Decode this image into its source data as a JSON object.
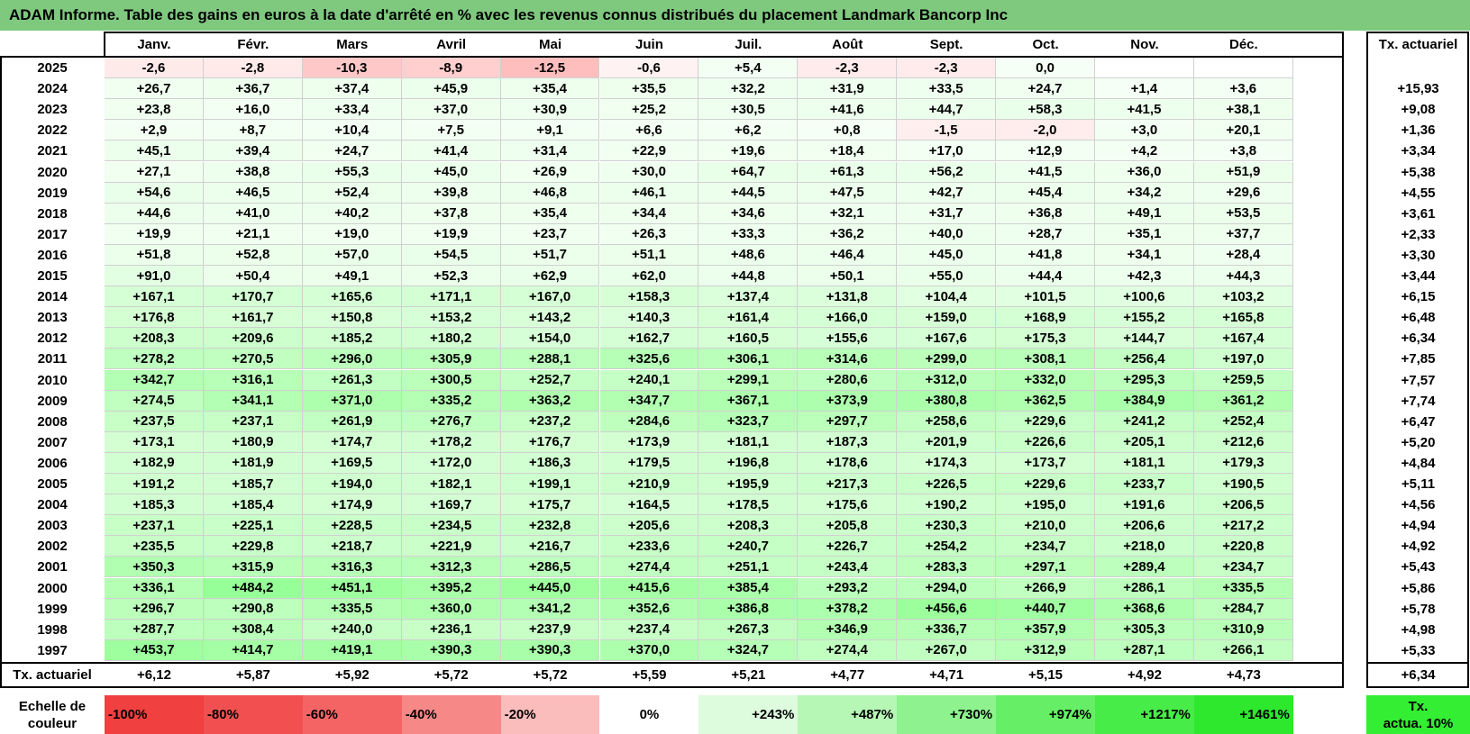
{
  "title": "ADAM Informe. Table des gains en euros à la date d'arrêté en % avec les revenus connus distribués du placement Landmark Bancorp Inc",
  "months": [
    "Janv.",
    "Févr.",
    "Mars",
    "Avril",
    "Mai",
    "Juin",
    "Juil.",
    "Août",
    "Sept.",
    "Oct.",
    "Nov.",
    "Déc."
  ],
  "annual_header": "Tx. actuariel",
  "rows": [
    {
      "year": "2025",
      "values": [
        "-2,6",
        "-2,8",
        "-10,3",
        "-8,9",
        "-12,5",
        "-0,6",
        "+5,4",
        "-2,3",
        "-2,3",
        "0,0",
        "",
        ""
      ],
      "annual": ""
    },
    {
      "year": "2024",
      "values": [
        "+26,7",
        "+36,7",
        "+37,4",
        "+45,9",
        "+35,4",
        "+35,5",
        "+32,2",
        "+31,9",
        "+33,5",
        "+24,7",
        "+1,4",
        "+3,6"
      ],
      "annual": "+15,93"
    },
    {
      "year": "2023",
      "values": [
        "+23,8",
        "+16,0",
        "+33,4",
        "+37,0",
        "+30,9",
        "+25,2",
        "+30,5",
        "+41,6",
        "+44,7",
        "+58,3",
        "+41,5",
        "+38,1"
      ],
      "annual": "+9,08"
    },
    {
      "year": "2022",
      "values": [
        "+2,9",
        "+8,7",
        "+10,4",
        "+7,5",
        "+9,1",
        "+6,6",
        "+6,2",
        "+0,8",
        "-1,5",
        "-2,0",
        "+3,0",
        "+20,1"
      ],
      "annual": "+1,36"
    },
    {
      "year": "2021",
      "values": [
        "+45,1",
        "+39,4",
        "+24,7",
        "+41,4",
        "+31,4",
        "+22,9",
        "+19,6",
        "+18,4",
        "+17,0",
        "+12,9",
        "+4,2",
        "+3,8"
      ],
      "annual": "+3,34"
    },
    {
      "year": "2020",
      "values": [
        "+27,1",
        "+38,8",
        "+55,3",
        "+45,0",
        "+26,9",
        "+30,0",
        "+64,7",
        "+61,3",
        "+56,2",
        "+41,5",
        "+36,0",
        "+51,9"
      ],
      "annual": "+5,38"
    },
    {
      "year": "2019",
      "values": [
        "+54,6",
        "+46,5",
        "+52,4",
        "+39,8",
        "+46,8",
        "+46,1",
        "+44,5",
        "+47,5",
        "+42,7",
        "+45,4",
        "+34,2",
        "+29,6"
      ],
      "annual": "+4,55"
    },
    {
      "year": "2018",
      "values": [
        "+44,6",
        "+41,0",
        "+40,2",
        "+37,8",
        "+35,4",
        "+34,4",
        "+34,6",
        "+32,1",
        "+31,7",
        "+36,8",
        "+49,1",
        "+53,5"
      ],
      "annual": "+3,61"
    },
    {
      "year": "2017",
      "values": [
        "+19,9",
        "+21,1",
        "+19,0",
        "+19,9",
        "+23,7",
        "+26,3",
        "+33,3",
        "+36,2",
        "+40,0",
        "+28,7",
        "+35,1",
        "+37,7"
      ],
      "annual": "+2,33"
    },
    {
      "year": "2016",
      "values": [
        "+51,8",
        "+52,8",
        "+57,0",
        "+54,5",
        "+51,7",
        "+51,1",
        "+48,6",
        "+46,4",
        "+45,0",
        "+41,8",
        "+34,1",
        "+28,4"
      ],
      "annual": "+3,30"
    },
    {
      "year": "2015",
      "values": [
        "+91,0",
        "+50,4",
        "+49,1",
        "+52,3",
        "+62,9",
        "+62,0",
        "+44,8",
        "+50,1",
        "+55,0",
        "+44,4",
        "+42,3",
        "+44,3"
      ],
      "annual": "+3,44"
    },
    {
      "year": "2014",
      "values": [
        "+167,1",
        "+170,7",
        "+165,6",
        "+171,1",
        "+167,0",
        "+158,3",
        "+137,4",
        "+131,8",
        "+104,4",
        "+101,5",
        "+100,6",
        "+103,2"
      ],
      "annual": "+6,15"
    },
    {
      "year": "2013",
      "values": [
        "+176,8",
        "+161,7",
        "+150,8",
        "+153,2",
        "+143,2",
        "+140,3",
        "+161,4",
        "+166,0",
        "+159,0",
        "+168,9",
        "+155,2",
        "+165,8"
      ],
      "annual": "+6,48"
    },
    {
      "year": "2012",
      "values": [
        "+208,3",
        "+209,6",
        "+185,2",
        "+180,2",
        "+154,0",
        "+162,7",
        "+160,5",
        "+155,6",
        "+167,6",
        "+175,3",
        "+144,7",
        "+167,4"
      ],
      "annual": "+6,34"
    },
    {
      "year": "2011",
      "values": [
        "+278,2",
        "+270,5",
        "+296,0",
        "+305,9",
        "+288,1",
        "+325,6",
        "+306,1",
        "+314,6",
        "+299,0",
        "+308,1",
        "+256,4",
        "+197,0"
      ],
      "annual": "+7,85"
    },
    {
      "year": "2010",
      "values": [
        "+342,7",
        "+316,1",
        "+261,3",
        "+300,5",
        "+252,7",
        "+240,1",
        "+299,1",
        "+280,6",
        "+312,0",
        "+332,0",
        "+295,3",
        "+259,5"
      ],
      "annual": "+7,57"
    },
    {
      "year": "2009",
      "values": [
        "+274,5",
        "+341,1",
        "+371,0",
        "+335,2",
        "+363,2",
        "+347,7",
        "+367,1",
        "+373,9",
        "+380,8",
        "+362,5",
        "+384,9",
        "+361,2"
      ],
      "annual": "+7,74"
    },
    {
      "year": "2008",
      "values": [
        "+237,5",
        "+237,1",
        "+261,9",
        "+276,7",
        "+237,2",
        "+284,6",
        "+323,7",
        "+297,7",
        "+258,6",
        "+229,6",
        "+241,2",
        "+252,4"
      ],
      "annual": "+6,47"
    },
    {
      "year": "2007",
      "values": [
        "+173,1",
        "+180,9",
        "+174,7",
        "+178,2",
        "+176,7",
        "+173,9",
        "+181,1",
        "+187,3",
        "+201,9",
        "+226,6",
        "+205,1",
        "+212,6"
      ],
      "annual": "+5,20"
    },
    {
      "year": "2006",
      "values": [
        "+182,9",
        "+181,9",
        "+169,5",
        "+172,0",
        "+186,3",
        "+179,5",
        "+196,8",
        "+178,6",
        "+174,3",
        "+173,7",
        "+181,1",
        "+179,3"
      ],
      "annual": "+4,84"
    },
    {
      "year": "2005",
      "values": [
        "+191,2",
        "+185,7",
        "+194,0",
        "+182,1",
        "+199,1",
        "+210,9",
        "+195,9",
        "+217,3",
        "+226,5",
        "+229,6",
        "+233,7",
        "+190,5"
      ],
      "annual": "+5,11"
    },
    {
      "year": "2004",
      "values": [
        "+185,3",
        "+185,4",
        "+174,9",
        "+169,7",
        "+175,7",
        "+164,5",
        "+178,5",
        "+175,6",
        "+190,2",
        "+195,0",
        "+191,6",
        "+206,5"
      ],
      "annual": "+4,56"
    },
    {
      "year": "2003",
      "values": [
        "+237,1",
        "+225,1",
        "+228,5",
        "+234,5",
        "+232,8",
        "+205,6",
        "+208,3",
        "+205,8",
        "+230,3",
        "+210,0",
        "+206,6",
        "+217,2"
      ],
      "annual": "+4,94"
    },
    {
      "year": "2002",
      "values": [
        "+235,5",
        "+229,8",
        "+218,7",
        "+221,9",
        "+216,7",
        "+233,6",
        "+240,7",
        "+226,7",
        "+254,2",
        "+234,7",
        "+218,0",
        "+220,8"
      ],
      "annual": "+4,92"
    },
    {
      "year": "2001",
      "values": [
        "+350,3",
        "+315,9",
        "+316,3",
        "+312,3",
        "+286,5",
        "+274,4",
        "+251,1",
        "+243,4",
        "+283,3",
        "+297,1",
        "+289,4",
        "+234,7"
      ],
      "annual": "+5,43"
    },
    {
      "year": "2000",
      "values": [
        "+336,1",
        "+484,2",
        "+451,1",
        "+395,2",
        "+445,0",
        "+415,6",
        "+385,4",
        "+293,2",
        "+294,0",
        "+266,9",
        "+286,1",
        "+335,5"
      ],
      "annual": "+5,86"
    },
    {
      "year": "1999",
      "values": [
        "+296,7",
        "+290,8",
        "+335,5",
        "+360,0",
        "+341,2",
        "+352,6",
        "+386,8",
        "+378,2",
        "+456,6",
        "+440,7",
        "+368,6",
        "+284,7"
      ],
      "annual": "+5,78"
    },
    {
      "year": "1998",
      "values": [
        "+287,7",
        "+308,4",
        "+240,0",
        "+236,1",
        "+237,9",
        "+237,4",
        "+267,3",
        "+346,9",
        "+336,7",
        "+357,9",
        "+305,3",
        "+310,9"
      ],
      "annual": "+4,98"
    },
    {
      "year": "1997",
      "values": [
        "+453,7",
        "+414,7",
        "+419,1",
        "+390,3",
        "+390,3",
        "+370,0",
        "+324,7",
        "+274,4",
        "+267,0",
        "+312,9",
        "+287,1",
        "+266,1"
      ],
      "annual": "+5,33"
    }
  ],
  "footer": {
    "label": "Tx. actuariel",
    "values": [
      "+6,12",
      "+5,87",
      "+5,92",
      "+5,72",
      "+5,72",
      "+5,59",
      "+5,21",
      "+4,77",
      "+4,71",
      "+5,15",
      "+4,92",
      "+4,73"
    ],
    "annual": "+6,34"
  },
  "scale": {
    "label_line1": "Echelle de",
    "label_line2": "couleur",
    "items": [
      {
        "text": "-100%",
        "color": "#f04040",
        "align": "left"
      },
      {
        "text": "-80%",
        "color": "#f25050",
        "align": "left"
      },
      {
        "text": "-60%",
        "color": "#f46464",
        "align": "left"
      },
      {
        "text": "-40%",
        "color": "#f78888",
        "align": "left"
      },
      {
        "text": "-20%",
        "color": "#fbbcbc",
        "align": "left"
      },
      {
        "text": "0%",
        "color": "#ffffff",
        "align": "center"
      },
      {
        "text": "+243%",
        "color": "#ddfbdd",
        "align": "right"
      },
      {
        "text": "+487%",
        "color": "#b6f7b6",
        "align": "right"
      },
      {
        "text": "+730%",
        "color": "#8ef38e",
        "align": "right"
      },
      {
        "text": "+974%",
        "color": "#66ef66",
        "align": "right"
      },
      {
        "text": "+1217%",
        "color": "#48ec48",
        "align": "right"
      },
      {
        "text": "+1461%",
        "color": "#2de82d",
        "align": "right"
      }
    ],
    "annual_line1": "Tx.",
    "annual_line2": "actua. 10%",
    "annual_color": "#33ee33"
  }
}
